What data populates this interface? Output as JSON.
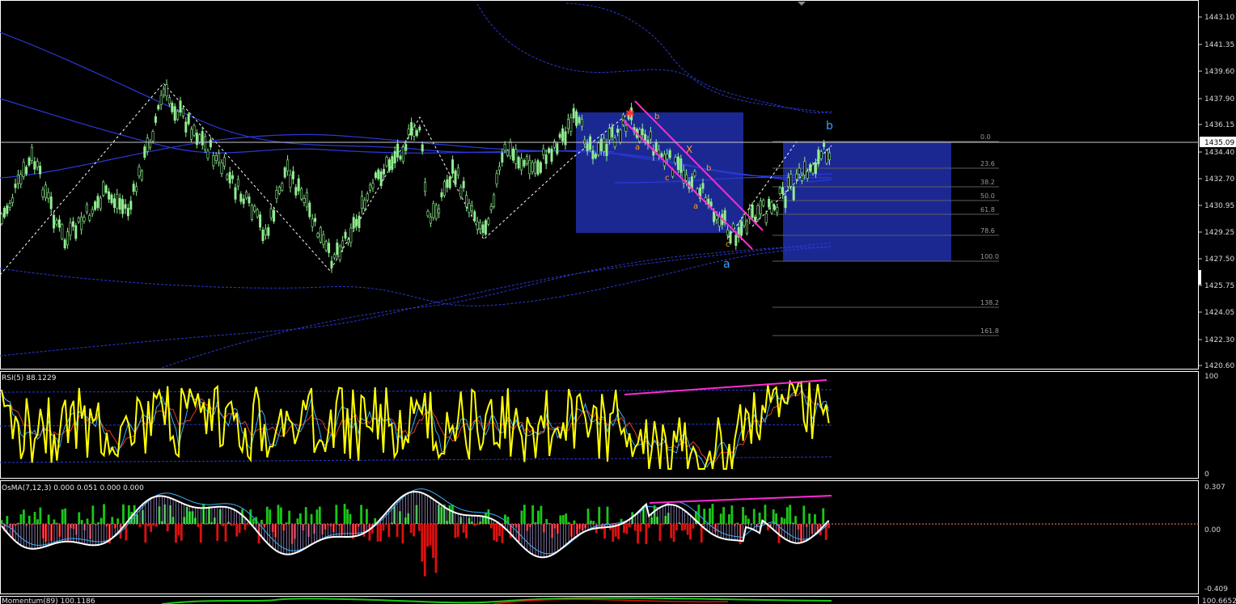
{
  "colors": {
    "background": "#000000",
    "frame": "#ffffff",
    "bull_candle": "#90ee90",
    "ma_blue": "#2b39d6",
    "channel": "#ff2bd6",
    "box_fill": "#1d2a9a",
    "rsi_line": "#ffff00",
    "wave_orange": "#ff9f1a",
    "wave_blue": "#3aa0ff",
    "osma_up": "#18c818",
    "osma_down": "#e01010",
    "fib_line": "#666666"
  },
  "price_panel": {
    "current_price": "1435.09",
    "axis_labels": [
      "1443.10",
      "1441.35",
      "1439.60",
      "1437.90",
      "1436.15",
      "1434.40",
      "1432.70",
      "1430.95",
      "1429.25",
      "1427.50",
      "1425.75",
      "1424.05",
      "1422.30",
      "1420.60"
    ],
    "fib_levels": [
      "0.0",
      "23.6",
      "38.2",
      "50.0",
      "61.8",
      "78.6",
      "100.0",
      "138.2",
      "161.8"
    ],
    "wave_labels_small": [
      "b",
      "a",
      "X",
      "c",
      "b",
      "a",
      "c"
    ],
    "wave_labels_big": [
      "b",
      "a"
    ]
  },
  "rsi_panel": {
    "title": "RSI(5) 88.1229",
    "axis_labels": [
      "100",
      "0"
    ]
  },
  "osma_panel": {
    "title": "OsMA(7,12,3) 0.000 0.051 0.000 0.000",
    "axis_labels": [
      "0.307",
      "0.00",
      "-0.409"
    ]
  },
  "momentum_panel": {
    "title": "Momentum(89) 100.1186",
    "axis_labels": [
      "100.6652"
    ]
  },
  "chart_data": {
    "type": "candlestick",
    "title": "",
    "ylim": [
      1420.6,
      1443.1
    ],
    "current_price": 1435.09,
    "wave_pivots_price": [
      1426.5,
      1438.9,
      1426.7,
      1436.8,
      1428.8,
      1437.2,
      1429.0,
      1435.1
    ],
    "fibonacci_retracement": {
      "levels_pct": [
        0.0,
        23.6,
        38.2,
        50.0,
        61.8,
        78.6,
        100.0,
        138.2,
        161.8
      ],
      "high": 1435.1,
      "low": 1427.6
    },
    "rsi": {
      "period": 5,
      "value": 88.1229,
      "range": [
        0,
        100
      ]
    },
    "osma": {
      "fast": 7,
      "slow": 12,
      "signal": 3,
      "values": [
        0.0,
        0.051,
        0.0,
        0.0
      ],
      "range": [
        -0.409,
        0.307
      ]
    },
    "momentum": {
      "period": 89,
      "value": 100.1186
    }
  }
}
